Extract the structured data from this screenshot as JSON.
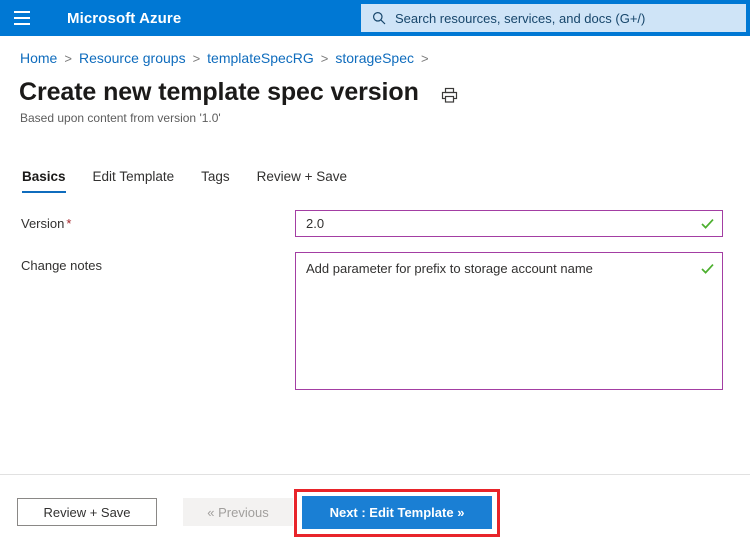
{
  "topbar": {
    "menu_icon": "hamburger-icon",
    "brand": "Microsoft Azure",
    "search": {
      "icon": "search-icon",
      "placeholder": "Search resources, services, and docs (G+/)",
      "value": ""
    }
  },
  "breadcrumb": {
    "separator": ">",
    "items": [
      {
        "label": "Home"
      },
      {
        "label": "Resource groups"
      },
      {
        "label": "templateSpecRG"
      },
      {
        "label": "storageSpec"
      }
    ]
  },
  "header": {
    "title": "Create new template spec version",
    "print_icon": "printer-icon",
    "subtitle": "Based upon content from version '1.0'"
  },
  "tabs": [
    {
      "label": "Basics",
      "active": true
    },
    {
      "label": "Edit Template",
      "active": false
    },
    {
      "label": "Tags",
      "active": false
    },
    {
      "label": "Review + Save",
      "active": false
    }
  ],
  "form": {
    "version": {
      "label": "Version",
      "required_mark": "*",
      "value": "2.0",
      "placeholder": "",
      "validation_icon": "checkmark-icon"
    },
    "change_notes": {
      "label": "Change notes",
      "value": "Add parameter for prefix to storage account name",
      "placeholder": "",
      "validation_icon": "checkmark-icon"
    }
  },
  "footer": {
    "review_save": "Review + Save",
    "previous": "« Previous",
    "next": "Next : Edit Template »"
  },
  "colors": {
    "header_blue": "#0078d4",
    "search_blue": "#cfe4f7",
    "link_blue": "#0f6cbd",
    "primary_button": "#1a7fd4",
    "field_border_purple": "#a33ea3",
    "valid_green": "#4caf2e",
    "required_red": "#a4262c",
    "highlight_red": "#e8242a"
  }
}
